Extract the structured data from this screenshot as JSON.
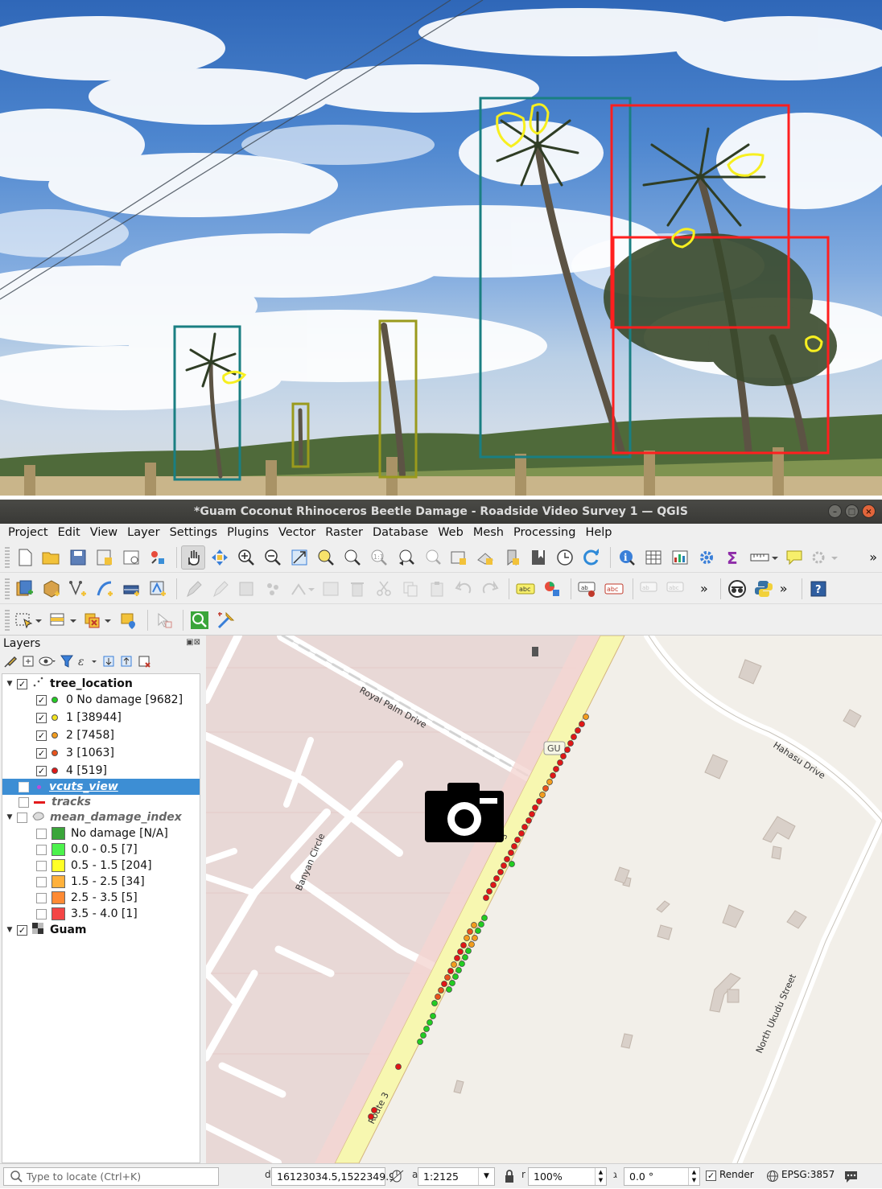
{
  "window": {
    "title": "*Guam Coconut Rhinoceros Beetle Damage - Roadside Video Survey 1 — QGIS"
  },
  "menu": [
    "Project",
    "Edit",
    "View",
    "Layer",
    "Settings",
    "Plugins",
    "Vector",
    "Raster",
    "Database",
    "Web",
    "Mesh",
    "Processing",
    "Help"
  ],
  "layers_panel": {
    "title": "Layers",
    "items": [
      {
        "label": "tree_location",
        "checked": true,
        "style": "bold",
        "expanded": true
      },
      {
        "label": "0 No damage [9682]",
        "checked": true,
        "color": "#22cc22"
      },
      {
        "label": "1 [38944]",
        "checked": true,
        "color": "#f2e41e"
      },
      {
        "label": "2 [7458]",
        "checked": true,
        "color": "#f29c1e"
      },
      {
        "label": "3 [1063]",
        "checked": true,
        "color": "#e8531c"
      },
      {
        "label": "4 [519]",
        "checked": true,
        "color": "#e01717"
      },
      {
        "label": "vcuts_view",
        "checked": false,
        "style": "italic-underline",
        "selected": true
      },
      {
        "label": "tracks",
        "checked": false,
        "style": "italic"
      },
      {
        "label": "mean_damage_index",
        "checked": false,
        "style": "italic",
        "expanded": true
      },
      {
        "label": "No damage [N/A]",
        "checked": false,
        "color": "#3aa53a"
      },
      {
        "label": "0.0 - 0.5 [7]",
        "checked": false,
        "color": "#4cf24c"
      },
      {
        "label": "0.5 - 1.5 [204]",
        "checked": false,
        "color": "#ffff26"
      },
      {
        "label": "1.5 - 2.5 [34]",
        "checked": false,
        "color": "#ffb13b"
      },
      {
        "label": "2.5 - 3.5 [5]",
        "checked": false,
        "color": "#ff8a33"
      },
      {
        "label": "3.5 - 4.0 [1]",
        "checked": false,
        "color": "#f44545"
      },
      {
        "label": "Guam",
        "checked": true,
        "style": "bold",
        "expanded": true
      }
    ]
  },
  "map": {
    "labels": {
      "royal_palm": "Royal Palm Drive",
      "banyan": "Banyan Circle",
      "hahasu": "Hahasu Drive",
      "north_ukudu": "North Ukudu Street",
      "route3": "Route 3",
      "shield": "GU"
    }
  },
  "statusbar": {
    "locate_placeholder": "Type to locate (Ctrl+K)",
    "coordinate_label": "d",
    "coordinate": "16123034.5,1522349.9",
    "scale_label": "a",
    "scale": "1:2125",
    "magnifier_label": "r",
    "magnifier": "100%",
    "rotation_label": "ג",
    "rotation": "0.0 °",
    "render_label": "Render",
    "render_checked": true,
    "crs": "EPSG:3857"
  }
}
